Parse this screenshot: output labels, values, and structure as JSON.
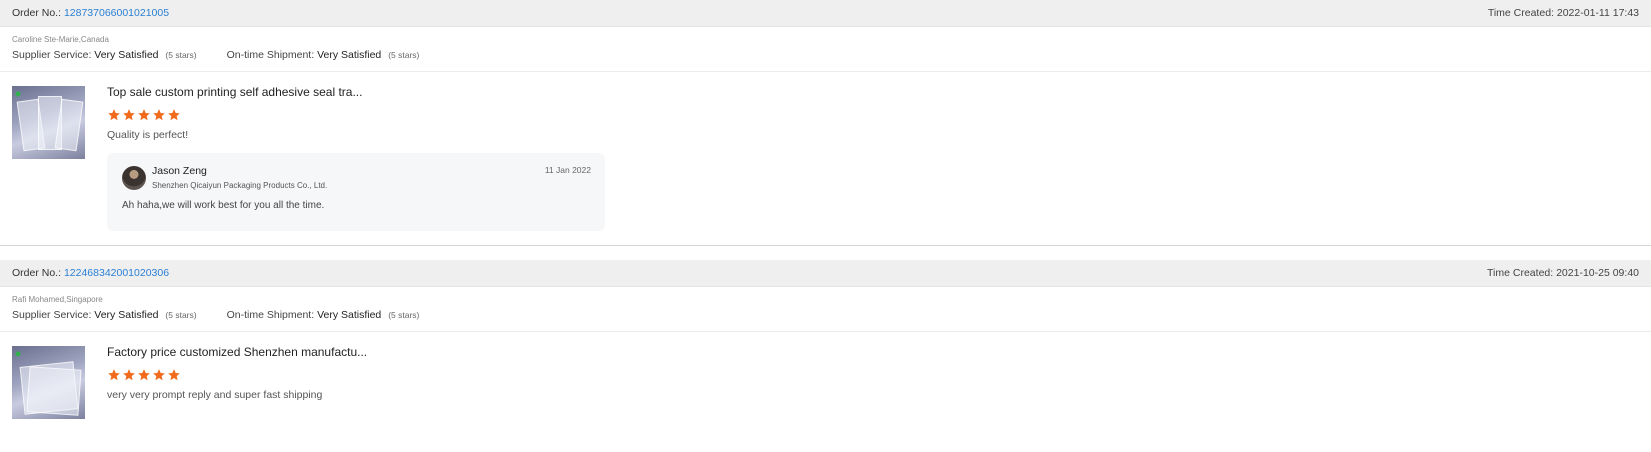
{
  "reviews": [
    {
      "order_label": "Order No.:",
      "order_no": "128737066001021005",
      "time_label": "Time Created:",
      "time_value": "2022-01-11 17:43",
      "buyer": "Caroline Ste-Marie,Canada",
      "supplier_service_label": "Supplier Service:",
      "supplier_service_value": "Very Satisfied",
      "supplier_service_stars": "(5 stars)",
      "shipment_label": "On-time Shipment:",
      "shipment_value": "Very Satisfied",
      "shipment_stars": "(5 stars)",
      "product_title": "Top sale custom printing self adhesive seal tra...",
      "rating": 5,
      "comment": "Quality is perfect!",
      "reply": {
        "name": "Jason Zeng",
        "company": "Shenzhen Qicaiyun Packaging Products Co., Ltd.",
        "date": "11 Jan 2022",
        "text": "Ah haha,we will work best for you all the time."
      }
    },
    {
      "order_label": "Order No.:",
      "order_no": "122468342001020306",
      "time_label": "Time Created:",
      "time_value": "2021-10-25 09:40",
      "buyer": "Rafi Mohamed,Singapore",
      "supplier_service_label": "Supplier Service:",
      "supplier_service_value": "Very Satisfied",
      "supplier_service_stars": "(5 stars)",
      "shipment_label": "On-time Shipment:",
      "shipment_value": "Very Satisfied",
      "shipment_stars": "(5 stars)",
      "product_title": "Factory price customized Shenzhen manufactu...",
      "rating": 5,
      "comment": "very very prompt reply and super fast shipping"
    }
  ],
  "colors": {
    "star": "#f26b1d",
    "link": "#2a7fd4",
    "bar": "#efefef"
  },
  "icons": {
    "star": "star-icon",
    "thumb_badge": "leaf-icon"
  }
}
